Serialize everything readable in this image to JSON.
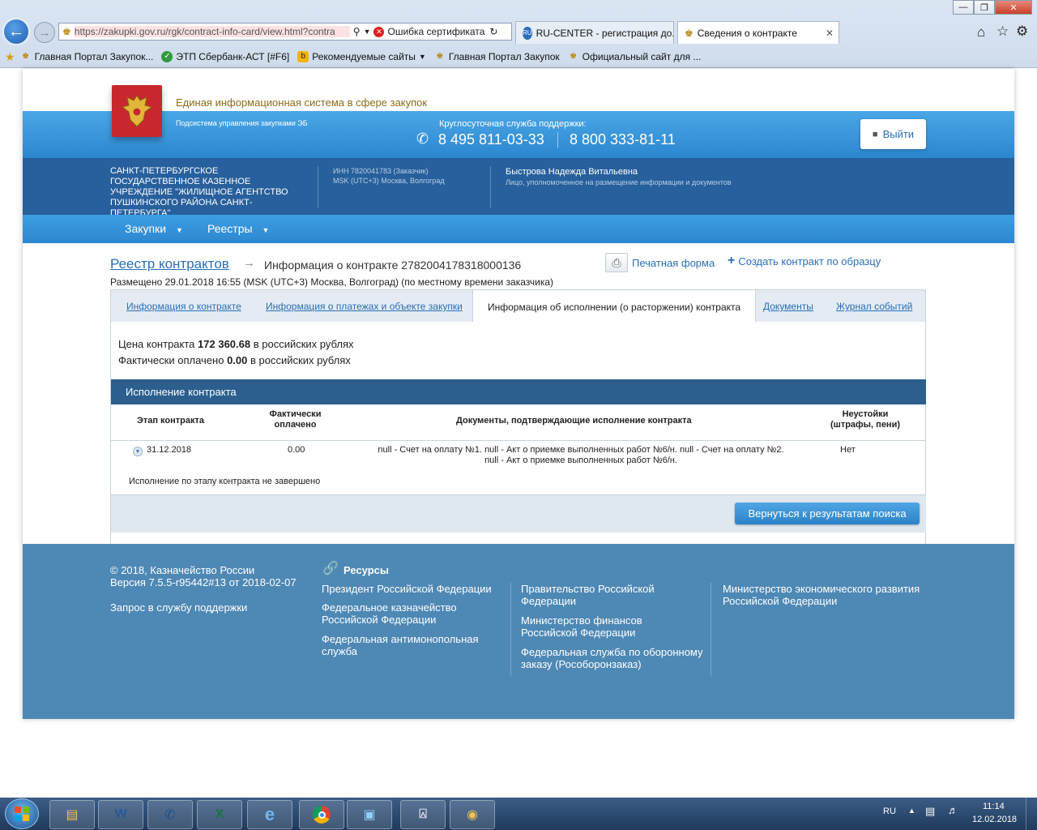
{
  "browser": {
    "url": "https://zakupki.gov.ru/rgk/contract-info-card/view.html?contra",
    "cert_error": "Ошибка сертификата",
    "tabs": [
      {
        "title": "RU-CENTER - регистрация до..."
      },
      {
        "title": "Сведения о контракте"
      }
    ],
    "favorites": [
      {
        "label": "Главная Портал Закупок..."
      },
      {
        "label": "ЭТП Сбербанк-АСТ [#F6]"
      },
      {
        "label": "Рекомендуемые сайты"
      },
      {
        "label": "Главная Портал Закупок"
      },
      {
        "label": "Официальный сайт для ..."
      }
    ]
  },
  "site": {
    "system_title": "Единая информационная система в сфере закупок",
    "subsystem": "Подсистема управления закупками ЭБ",
    "support_label": "Круглосуточная служба поддержки:",
    "phone1": "8 495 811-03-33",
    "phone2": "8 800 333-81-11",
    "logout": "Выйти"
  },
  "org": {
    "name": "САНКТ-ПЕТЕРБУРГСКОЕ ГОСУДАРСТВЕННОЕ КАЗЕННОЕ УЧРЕЖДЕНИЕ \"ЖИЛИЩНОЕ АГЕНТСТВО ПУШКИНСКОГО РАЙОНА САНКТ-ПЕТЕРБУРГА\"",
    "inn": "ИНН 7820041783 (Заказчик)",
    "tz": "MSK (UTC+3) Москва, Волгоград",
    "user_name": "Быстрова Надежда Витальевна",
    "user_role": "Лицо, уполномоченное на размещение информации и документов"
  },
  "menu": {
    "items": [
      {
        "label": "Закупки"
      },
      {
        "label": "Реестры"
      }
    ]
  },
  "page": {
    "breadcrumb_root": "Реестр контрактов",
    "breadcrumb_current": "Информация о контракте 2782004178318000136",
    "print_form": "Печатная форма",
    "create_by_sample": "Создать контракт по образцу",
    "placed": "Размещено 29.01.2018 16:55 (MSK (UTC+3) Москва, Волгоград) (по местному времени заказчика)",
    "tabs": [
      {
        "label": "Информация о контракте"
      },
      {
        "label": "Информация о платежах и объекте закупки"
      },
      {
        "label": "Информация об исполнении (о расторжении) контракта"
      },
      {
        "label": "Документы"
      },
      {
        "label": "Журнал событий"
      }
    ],
    "price_label": "Цена контракта",
    "price_value": "172 360.68",
    "price_unit": "в российских рублях",
    "paid_label": "Фактически оплачено",
    "paid_value": "0.00",
    "paid_unit": "в российских рублях",
    "section_title": "Исполнение контракта",
    "columns": {
      "stage": "Этап контракта",
      "paid": "Фактически оплачено",
      "docs": "Документы, подтверждающие исполнение контракта",
      "penalties": "Неустойки (штрафы, пени)"
    },
    "row": {
      "stage": "31.12.2018",
      "paid": "0.00",
      "docs_line1": "null - Счет на оплату №1. null - Акт о приемке выполненных работ №6/н. null - Счет на оплату №2.",
      "docs_line2": "null - Акт о приемке выполненных работ №6/н.",
      "penalties": "Нет"
    },
    "stage_status": "Исполнение по этапу контракта не завершено",
    "back_button": "Вернуться к результатам поиска"
  },
  "footer": {
    "copyright": "© 2018, Казначейство России",
    "version": "Версия 7.5.5-r95442#13 от 2018-02-07",
    "support": "Запрос в службу поддержки",
    "resources": "Ресурсы",
    "links": [
      "Президент Российской Федерации",
      "Федеральное казначейство Российской Федерации",
      "Федеральная антимонопольная служба",
      "Правительство Российской Федерации",
      "Министерство финансов Российской Федерации",
      "Федеральная служба по оборонному заказу (Рособоронзаказ)",
      "Министерство экономического развития Российской Федерации"
    ]
  },
  "taskbar": {
    "lang": "RU",
    "time": "11:14",
    "date": "12.02.2018"
  }
}
